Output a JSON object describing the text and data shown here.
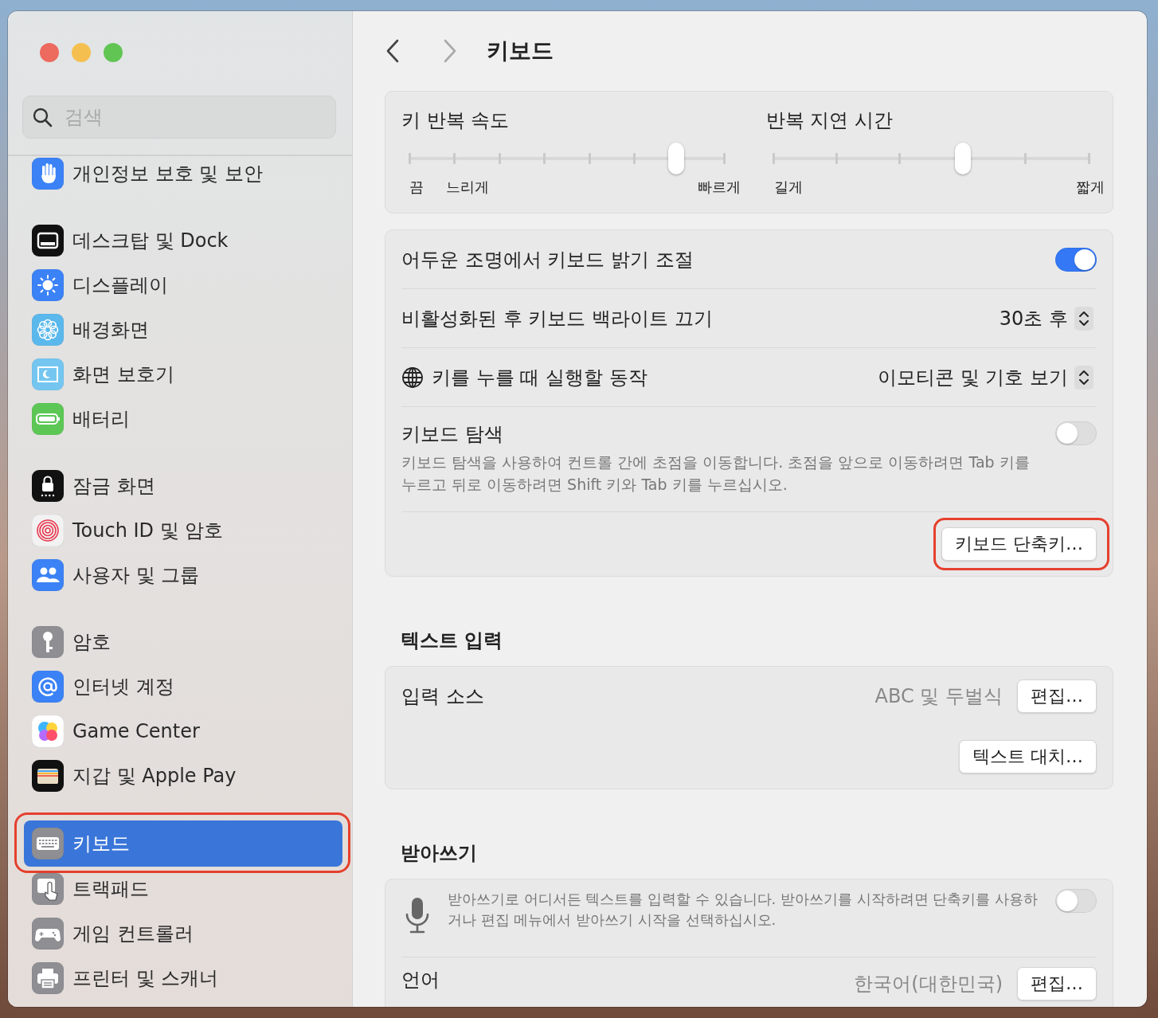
{
  "sidebar": {
    "search": {
      "placeholder": "검색"
    },
    "groups": [
      {
        "items": [
          {
            "label": "개인정보 보호 및 보안",
            "color": "#3b82f6",
            "selected": false,
            "highlighted": false
          }
        ]
      },
      {
        "items": [
          {
            "label": "데스크탑 및 Dock",
            "color": "#111111",
            "selected": false,
            "highlighted": false
          },
          {
            "label": "디스플레이",
            "color": "#3b82f6",
            "selected": false,
            "highlighted": false
          },
          {
            "label": "배경화면",
            "color": "#5ab8ec",
            "selected": false,
            "highlighted": false
          },
          {
            "label": "화면 보호기",
            "color": "#74c6f0",
            "selected": false,
            "highlighted": false
          },
          {
            "label": "배터리",
            "color": "#5cc755",
            "selected": false,
            "highlighted": false
          }
        ]
      },
      {
        "items": [
          {
            "label": "잠금 화면",
            "color": "#111111",
            "selected": false,
            "highlighted": false
          },
          {
            "label": "Touch ID 및 암호",
            "color": "#f2f2f2",
            "selected": false,
            "highlighted": false
          },
          {
            "label": "사용자 및 그룹",
            "color": "#3b82f6",
            "selected": false,
            "highlighted": false
          }
        ]
      },
      {
        "items": [
          {
            "label": "암호",
            "color": "#8e8e93",
            "selected": false,
            "highlighted": false
          },
          {
            "label": "인터넷 계정",
            "color": "#3b82f6",
            "selected": false,
            "highlighted": false
          },
          {
            "label": "Game Center",
            "color": "#ffffff",
            "selected": false,
            "highlighted": false
          },
          {
            "label": "지갑 및 Apple Pay",
            "color": "#111111",
            "selected": false,
            "highlighted": false
          }
        ]
      },
      {
        "items": [
          {
            "label": "키보드",
            "color": "#8e8e93",
            "selected": true,
            "highlighted": true
          },
          {
            "label": "트랙패드",
            "color": "#8e8e93",
            "selected": false,
            "highlighted": false
          },
          {
            "label": "게임 컨트롤러",
            "color": "#8e8e93",
            "selected": false,
            "highlighted": false
          },
          {
            "label": "프린터 및 스캐너",
            "color": "#8e8e93",
            "selected": false,
            "highlighted": false
          }
        ]
      }
    ]
  },
  "header": {
    "title": "키보드"
  },
  "sliders": [
    {
      "kind": "speed",
      "title": "키 반복 속도",
      "level": 0.846,
      "labels": [
        "끔",
        "느리게",
        "빠르게"
      ]
    },
    {
      "kind": "delay",
      "title": "반복 지연 시간",
      "level": 0.6,
      "labels": [
        "길게",
        "짧게"
      ]
    }
  ],
  "keyboard_settings": {
    "rows": [
      {
        "kind": "toggle",
        "label": "어두운 조명에서 키보드 밝기 조절",
        "on": true
      },
      {
        "kind": "popup",
        "label": "비활성화된 후 키보드 백라이트 끄기",
        "value": "30초 후"
      },
      {
        "kind": "globe-popup",
        "label": "키를 누를 때 실행할 동작",
        "value": "이모티콘 및 기호 보기"
      },
      {
        "kind": "toggle",
        "label": "키보드 탐색",
        "description": "키보드 탐색을 사용하여 컨트롤 간에 초점을 이동합니다. 초점을 앞으로 이동하려면 Tab 키를 누르고 뒤로 이동하려면 Shift 키와 Tab 키를 누르십시오.",
        "on": false
      },
      {
        "kind": "button",
        "label": "키보드 단축키…",
        "highlighted": true
      }
    ]
  },
  "sections": [
    {
      "title": "텍스트 입력",
      "rows": [
        {
          "kind": "value-button",
          "label": "입력 소스",
          "value": "ABC 및 두벌식",
          "button": "편집…"
        },
        {
          "kind": "button",
          "label": "텍스트 대치…",
          "highlighted": false
        }
      ]
    },
    {
      "title": "받아쓰기",
      "rows": [
        {
          "kind": "mic-toggle",
          "description": "받아쓰기로 어디서든 텍스트를 입력할 수 있습니다. 받아쓰기를 시작하려면 단축키를 사용하거나 편집 메뉴에서 받아쓰기 시작을 선택하십시오.",
          "on": false
        },
        {
          "kind": "value-button",
          "label": "언어",
          "value": "한국어(대한민국)",
          "button": "편집…"
        }
      ]
    }
  ]
}
